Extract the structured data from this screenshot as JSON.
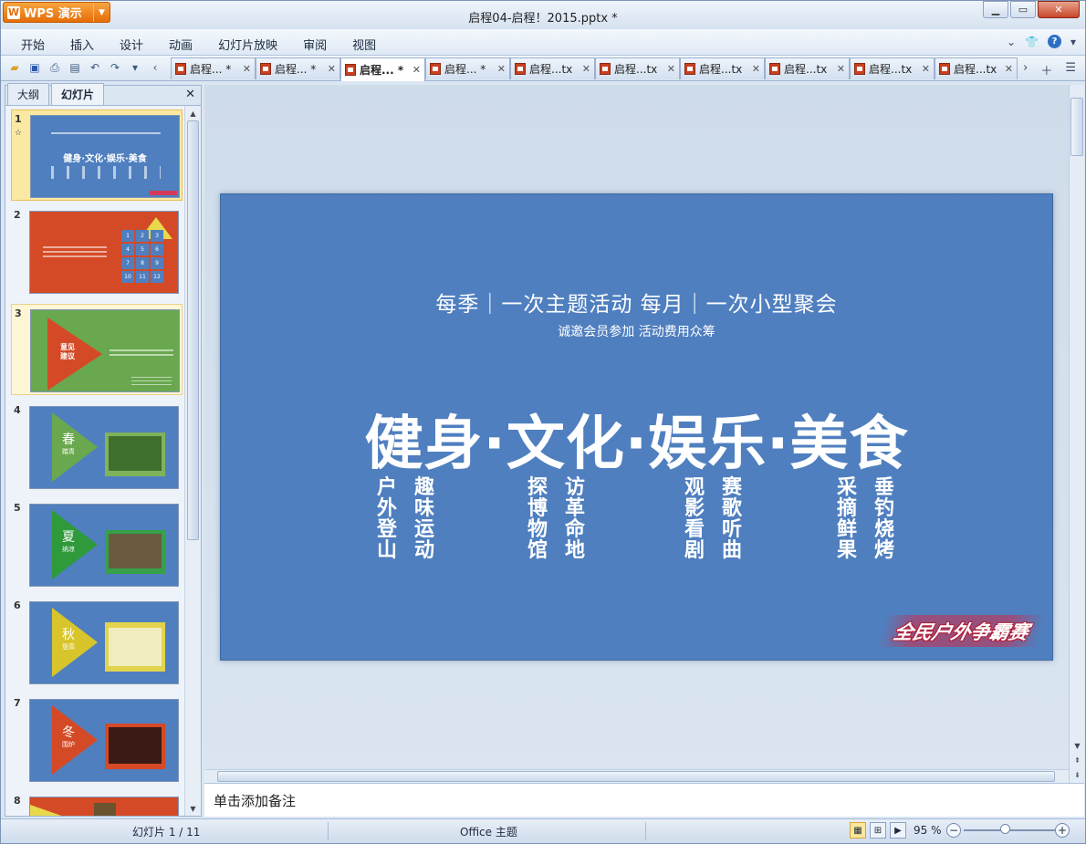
{
  "app": {
    "name": "WPS 演示",
    "window_title": "启程04-启程！2015.pptx *"
  },
  "menu": [
    "开始",
    "插入",
    "设计",
    "动画",
    "幻灯片放映",
    "审阅",
    "视图"
  ],
  "tabs": [
    "启程... *",
    "启程... *",
    "启程... *",
    "启程... *",
    "启程...tx",
    "启程...tx",
    "启程...tx",
    "启程...tx",
    "启程...tx",
    "启程...tx"
  ],
  "leftpane": {
    "tab_outline": "大纲",
    "tab_slides": "幻灯片"
  },
  "slide_numbers": [
    "1",
    "2",
    "3",
    "4",
    "5",
    "6",
    "7",
    "8"
  ],
  "thumb": {
    "t2_nums": [
      "1",
      "2",
      "3",
      "4",
      "5",
      "6",
      "7",
      "8",
      "9",
      "10",
      "11",
      "12"
    ],
    "t3_label": "意见\n建议",
    "t4_label": "春",
    "t4_sub": "踏青",
    "t5_label": "夏",
    "t5_sub": "纳凉",
    "t6_label": "秋",
    "t6_sub": "登高",
    "t7_label": "冬",
    "t7_sub": "围炉"
  },
  "slide": {
    "line1": "每季｜一次主题活动      每月｜一次小型聚会",
    "line2": "诚邀会员参加    活动费用众筹",
    "headline": "健身·文化·娱乐·美食",
    "columns": [
      "户外登山",
      "趣味运动",
      "探博物馆",
      "访革命地",
      "观影看剧",
      "赛歌听曲",
      "采摘鲜果",
      "垂钓烧烤"
    ],
    "logo_text": "全民户外争霸赛"
  },
  "notes_placeholder": "单击添加备注",
  "status": {
    "slide_counter": "幻灯片 1 / 11",
    "theme": "Office 主题",
    "zoom": "95 %"
  },
  "colors": {
    "slide_bg": "#4f7fbf",
    "red": "#d44a26",
    "green": "#6aa84f",
    "accent_orange": "#e56d07"
  }
}
